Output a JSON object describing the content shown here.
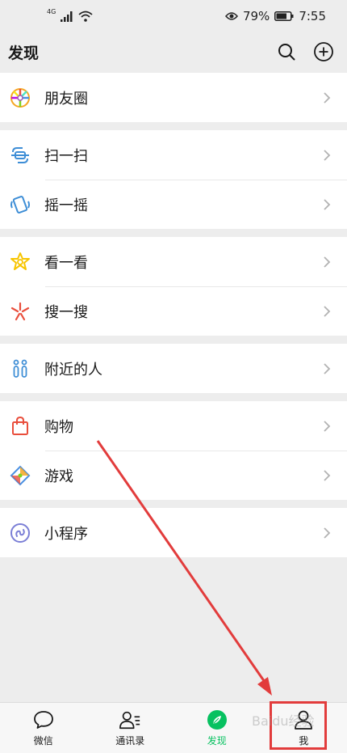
{
  "status": {
    "signal": "4G",
    "battery": "79%",
    "time": "7:55"
  },
  "header": {
    "title": "发现"
  },
  "groups": [
    {
      "items": [
        {
          "label": "朋友圈",
          "icon": "moments-icon"
        }
      ]
    },
    {
      "items": [
        {
          "label": "扫一扫",
          "icon": "scan-icon"
        },
        {
          "label": "摇一摇",
          "icon": "shake-icon"
        }
      ]
    },
    {
      "items": [
        {
          "label": "看一看",
          "icon": "top-stories-icon"
        },
        {
          "label": "搜一搜",
          "icon": "search-icon"
        }
      ]
    },
    {
      "items": [
        {
          "label": "附近的人",
          "icon": "people-nearby-icon"
        }
      ]
    },
    {
      "items": [
        {
          "label": "购物",
          "icon": "shopping-bag-icon"
        },
        {
          "label": "游戏",
          "icon": "games-icon"
        }
      ]
    },
    {
      "items": [
        {
          "label": "小程序",
          "icon": "mini-programs-icon"
        }
      ]
    }
  ],
  "tabs": [
    {
      "label": "微信",
      "icon": "chat-bubble-icon",
      "active": false
    },
    {
      "label": "通讯录",
      "icon": "contacts-icon",
      "active": false
    },
    {
      "label": "发现",
      "icon": "compass-icon",
      "active": true
    },
    {
      "label": "我",
      "icon": "profile-icon",
      "active": false
    }
  ],
  "watermark": "Baidu经验",
  "colors": {
    "accent": "#07c160",
    "annotation": "#e23c3c",
    "background": "#ededed"
  }
}
